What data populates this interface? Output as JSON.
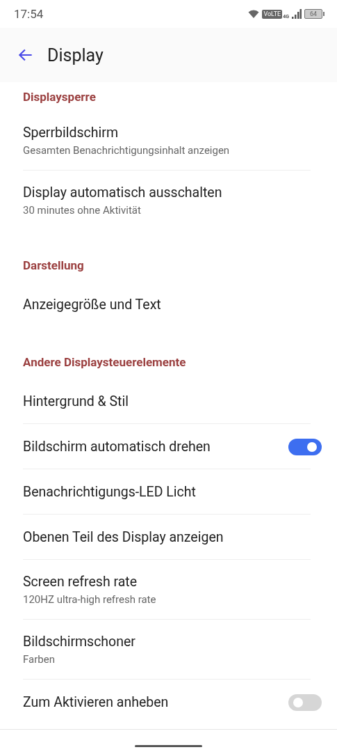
{
  "status_bar": {
    "time": "17:54",
    "volte": "VoLTE",
    "network": "4G",
    "battery": "64"
  },
  "app_bar": {
    "title": "Display"
  },
  "sections": [
    {
      "title": "Displaysperre",
      "items": [
        {
          "kind": "text",
          "title": "Sperrbildschirm",
          "subtitle": "Gesamten Benachrichtigungsinhalt anzeigen"
        },
        {
          "kind": "text",
          "title": "Display automatisch ausschalten",
          "subtitle": "30 minutes ohne Aktivität"
        }
      ]
    },
    {
      "title": "Darstellung",
      "items": [
        {
          "kind": "text",
          "title": "Anzeigegröße und Text"
        }
      ]
    },
    {
      "title": "Andere Displaysteuerelemente",
      "items": [
        {
          "kind": "text",
          "title": "Hintergrund & Stil"
        },
        {
          "kind": "switch",
          "title": "Bildschirm automatisch drehen",
          "on": true
        },
        {
          "kind": "text",
          "title": "Benachrichtigungs-LED Licht"
        },
        {
          "kind": "text",
          "title": "Obenen Teil des Display anzeigen"
        },
        {
          "kind": "text",
          "title": "Screen refresh rate",
          "subtitle": "120HZ ultra-high refresh rate"
        },
        {
          "kind": "text",
          "title": "Bildschirmschoner",
          "subtitle": "Farben"
        },
        {
          "kind": "switch",
          "title": "Zum Aktivieren anheben",
          "on": false
        }
      ]
    }
  ]
}
